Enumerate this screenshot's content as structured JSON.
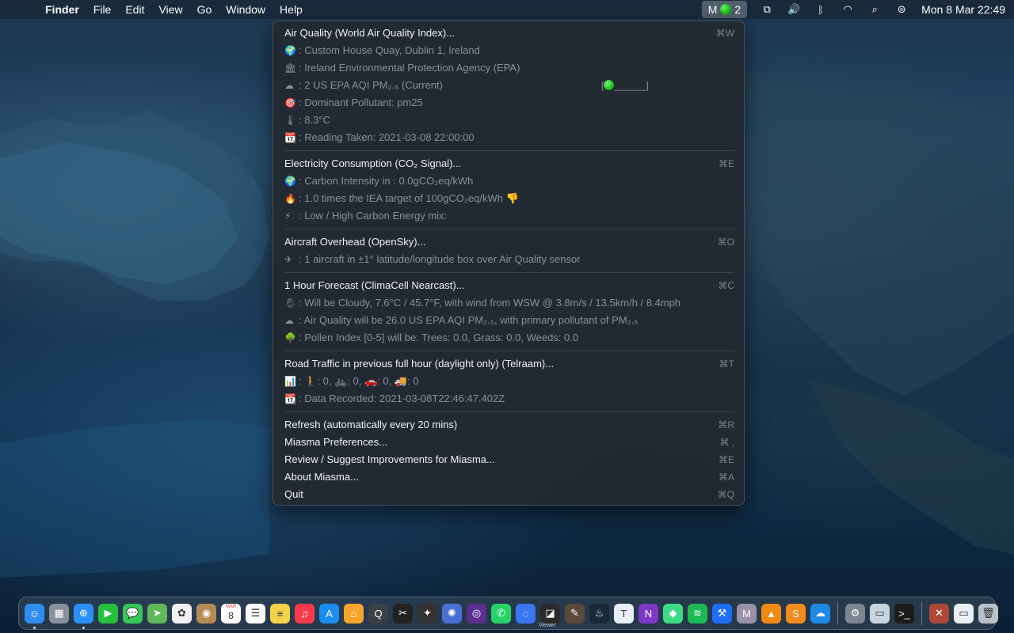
{
  "menubar": {
    "apple_icon": "apple-icon",
    "app_name": "Finder",
    "menus": [
      "File",
      "Edit",
      "View",
      "Go",
      "Window",
      "Help"
    ],
    "miasma_status": {
      "letter": "M",
      "value": "2"
    },
    "status_icons": [
      "display-icon",
      "volume-icon",
      "bluetooth-icon",
      "wifi-icon",
      "spotlight-icon",
      "control-center-icon"
    ],
    "clock": "Mon 8 Mar  22:49"
  },
  "menu": {
    "sections": [
      {
        "header": "Air Quality (World Air Quality Index)...",
        "shortcut": "⌘W",
        "items": [
          {
            "icon": "globe-icon",
            "glyph": "🌍",
            "text": ": Custom House Quay, Dublin 1, Ireland"
          },
          {
            "icon": "building-icon",
            "glyph": "🏛",
            "text": ": Ireland Environmental Protection Agency (EPA)"
          },
          {
            "icon": "cloud-icon",
            "glyph": "☁",
            "text": ": 2 US EPA AQI PM₂.₅ (Current)",
            "gauge_prefix": "[",
            "gauge_suffix": "______]"
          },
          {
            "icon": "target-icon",
            "glyph": "🎯",
            "text": ": Dominant Pollutant: pm25"
          },
          {
            "icon": "thermometer-icon",
            "glyph": "🌡",
            "text": ": 8.3°C"
          },
          {
            "icon": "calendar-icon",
            "glyph": "📆",
            "text": ": Reading Taken: 2021-03-08 22:00:00"
          }
        ]
      },
      {
        "header": "Electricity Consumption (CO₂ Signal)...",
        "shortcut": "⌘E",
        "items": [
          {
            "icon": "globe-icon",
            "glyph": "🌍",
            "text": ": Carbon Intensity in : 0.0gCO₂eq/kWh"
          },
          {
            "icon": "fire-icon",
            "glyph": "🔥",
            "text": ": 1.0 times the IEA target of 100gCO₂eq/kWh 👎"
          },
          {
            "icon": "lightning-icon",
            "glyph": "⚡",
            "text": ": Low / High Carbon Energy mix:"
          }
        ]
      },
      {
        "header": "Aircraft Overhead (OpenSky)...",
        "shortcut": "⌘O",
        "items": [
          {
            "icon": "airplane-icon",
            "glyph": "✈",
            "text": ": 1 aircraft in ±1° latitude/longitude box over Air Quality sensor"
          }
        ]
      },
      {
        "header": "1 Hour Forecast (ClimaCell Nearcast)...",
        "shortcut": "⌘C",
        "items": [
          {
            "icon": "sun-cloud-icon",
            "glyph": "🌦",
            "text": ": Will be Cloudy, 7.6°C / 45.7°F, with wind from WSW @ 3.8m/s / 13.5km/h / 8.4mph"
          },
          {
            "icon": "cloud-icon",
            "glyph": "☁",
            "text": ": Air Quality will be 26.0 US EPA AQI PM₂.₅, with primary pollutant of PM₂.₅"
          },
          {
            "icon": "tree-icon",
            "glyph": "🌳",
            "text": ": Pollen Index [0-5] will be: Trees: 0.0, Grass: 0.0, Weeds: 0.0"
          }
        ]
      },
      {
        "header": "Road Traffic in previous full hour (daylight only) (Telraam)...",
        "shortcut": "⌘T",
        "items": [
          {
            "icon": "bar-chart-icon",
            "glyph": "📊",
            "text": ": 🚶: 0, 🚲: 0, 🚗: 0, 🚚: 0"
          },
          {
            "icon": "calendar-icon",
            "glyph": "📆",
            "text": ": Data Recorded: 2021-03-08T22:46:47.402Z"
          }
        ]
      }
    ],
    "actions": [
      {
        "label": "Refresh (automatically every 20 mins)",
        "shortcut": "⌘R"
      },
      {
        "label": "Miasma Preferences...",
        "shortcut": "⌘ ,"
      },
      {
        "label": "Review / Suggest Improvements for Miasma...",
        "shortcut": "⌘E"
      },
      {
        "label": "About Miasma...",
        "shortcut": "⌘A"
      },
      {
        "label": "Quit",
        "shortcut": "⌘Q"
      }
    ]
  },
  "dock": {
    "apps": [
      {
        "name": "finder-icon",
        "color": "#2f8df0",
        "glyph": "☺",
        "running": true
      },
      {
        "name": "launchpad-icon",
        "color": "#8a8f99",
        "glyph": "▦"
      },
      {
        "name": "safari-icon",
        "color": "#2a8ff7",
        "glyph": "⊕",
        "running": true
      },
      {
        "name": "facetime-icon",
        "color": "#27c03c",
        "glyph": "▶"
      },
      {
        "name": "messages-icon",
        "color": "#34c759",
        "glyph": "💬"
      },
      {
        "name": "maps-icon",
        "color": "#5fb85a",
        "glyph": "➤"
      },
      {
        "name": "photos-icon",
        "color": "#f2f2f2",
        "glyph": "✿"
      },
      {
        "name": "contacts-icon",
        "color": "#b58a55",
        "glyph": "◉"
      },
      {
        "name": "calendar-icon",
        "color": "#ffffff",
        "glyph": "8",
        "label": "MAR"
      },
      {
        "name": "reminders-icon",
        "color": "#fafafa",
        "glyph": "☰"
      },
      {
        "name": "notes-icon",
        "color": "#f6d24a",
        "glyph": "≡"
      },
      {
        "name": "music-icon",
        "color": "#fa3b4e",
        "glyph": "♫"
      },
      {
        "name": "app-store-icon",
        "color": "#1b8cf2",
        "glyph": "A"
      },
      {
        "name": "home-icon",
        "color": "#f7a52b",
        "glyph": "⌂"
      },
      {
        "name": "quicktime-icon",
        "color": "#3b4047",
        "glyph": "Q"
      },
      {
        "name": "final-cut-icon",
        "color": "#222",
        "glyph": "✂"
      },
      {
        "name": "motion-icon",
        "color": "#333",
        "glyph": "✦"
      },
      {
        "name": "compressor-icon",
        "color": "#4a6fd3",
        "glyph": "✺"
      },
      {
        "name": "camera-app-icon",
        "color": "#5a2f8f",
        "glyph": "◎"
      },
      {
        "name": "whatsapp-icon",
        "color": "#25d366",
        "glyph": "✆"
      },
      {
        "name": "signal-icon",
        "color": "#3a76f0",
        "glyph": "◌"
      },
      {
        "name": "viewer-icon",
        "color": "#2b2b2b",
        "glyph": "◪",
        "label": "Viewer"
      },
      {
        "name": "pencil-icon",
        "color": "#5a4a3a",
        "glyph": "✎"
      },
      {
        "name": "steam-icon",
        "color": "#1b2838",
        "glyph": "♨"
      },
      {
        "name": "typora-icon",
        "color": "#e8eef5",
        "glyph": "T"
      },
      {
        "name": "onenote-icon",
        "color": "#7d39c6",
        "glyph": "N"
      },
      {
        "name": "android-icon",
        "color": "#3ddc84",
        "glyph": "◆"
      },
      {
        "name": "spotify-icon",
        "color": "#1db954",
        "glyph": "≋"
      },
      {
        "name": "xcode-icon",
        "color": "#1d6ef5",
        "glyph": "⚒"
      },
      {
        "name": "miasma-icon",
        "color": "#9a90a8",
        "glyph": "M"
      },
      {
        "name": "vlc-icon",
        "color": "#f08a12",
        "glyph": "▲"
      },
      {
        "name": "sublime-icon",
        "color": "#f38a1e",
        "glyph": "S"
      },
      {
        "name": "cloud-app-icon",
        "color": "#1e88e5",
        "glyph": "☁"
      }
    ],
    "system": [
      {
        "name": "system-preferences-icon",
        "color": "#7d8590",
        "glyph": "⚙"
      },
      {
        "name": "disk-utility-icon",
        "color": "#c9d4df",
        "glyph": "▭"
      },
      {
        "name": "terminal-icon",
        "color": "#1c1c1c",
        "glyph": ">_"
      }
    ],
    "right": [
      {
        "name": "x11-icon",
        "color": "#b0483a",
        "glyph": "✕"
      },
      {
        "name": "downloads-icon",
        "color": "#e9eef3",
        "glyph": "▭"
      },
      {
        "name": "trash-icon",
        "color": "#b9c0c8",
        "glyph": "🗑"
      }
    ]
  }
}
